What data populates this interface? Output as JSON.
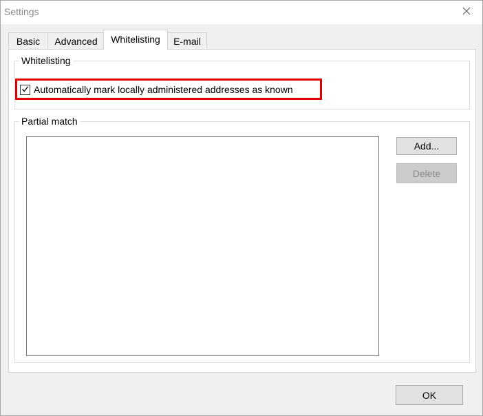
{
  "window": {
    "title": "Settings",
    "close_icon": "close-icon"
  },
  "tabs": [
    {
      "label": "Basic",
      "active": false
    },
    {
      "label": "Advanced",
      "active": false
    },
    {
      "label": "Whitelisting",
      "active": true
    },
    {
      "label": "E-mail",
      "active": false
    }
  ],
  "whitelisting_group": {
    "legend": "Whitelisting",
    "checkbox_label": "Automatically mark locally administered addresses as known",
    "checkbox_checked": true,
    "highlight_color": "#e00000"
  },
  "partial_match_group": {
    "legend": "Partial match",
    "items": [],
    "add_label": "Add...",
    "delete_label": "Delete",
    "delete_enabled": false
  },
  "footer": {
    "ok_label": "OK"
  }
}
